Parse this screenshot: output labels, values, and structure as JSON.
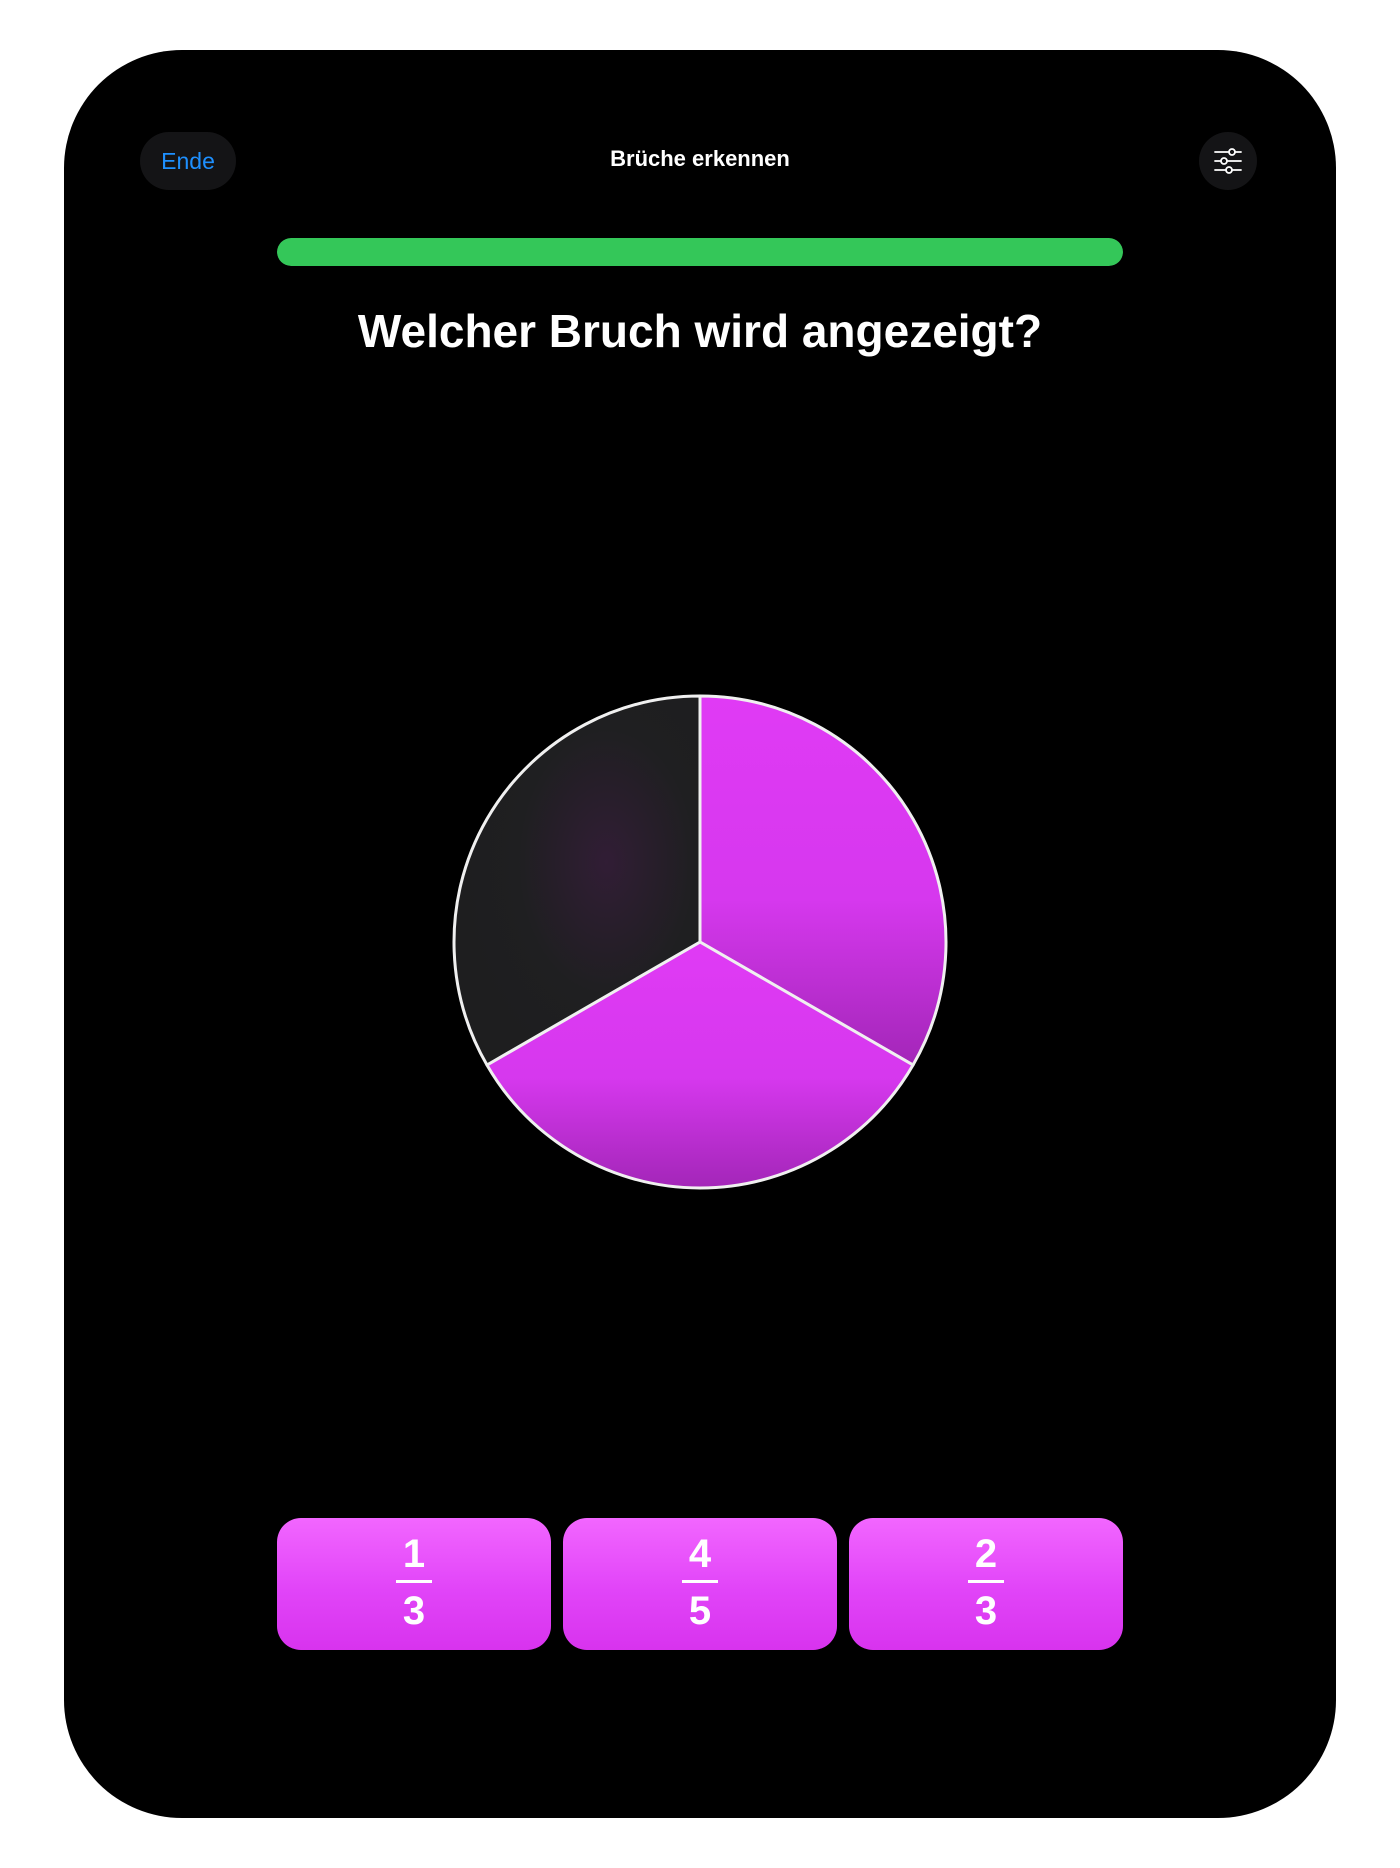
{
  "header": {
    "end_label": "Ende",
    "title": "Brüche erkennen",
    "settings_icon": "sliders-icon"
  },
  "progress": {
    "fraction": 1.0,
    "color": "#34c759"
  },
  "question": "Welcher Bruch wird angezeigt?",
  "pie": {
    "total_slices": 3,
    "filled_slices": 2,
    "fill_color": "#d838ee",
    "empty_color": "#1f1f21",
    "outline_color": "#f0f0f0"
  },
  "answers": [
    {
      "numerator": "1",
      "denominator": "3"
    },
    {
      "numerator": "4",
      "denominator": "5"
    },
    {
      "numerator": "2",
      "denominator": "3"
    }
  ],
  "colors": {
    "background": "#000000",
    "accent_blue": "#1e90ff",
    "answer_pink": "#e144f8"
  }
}
